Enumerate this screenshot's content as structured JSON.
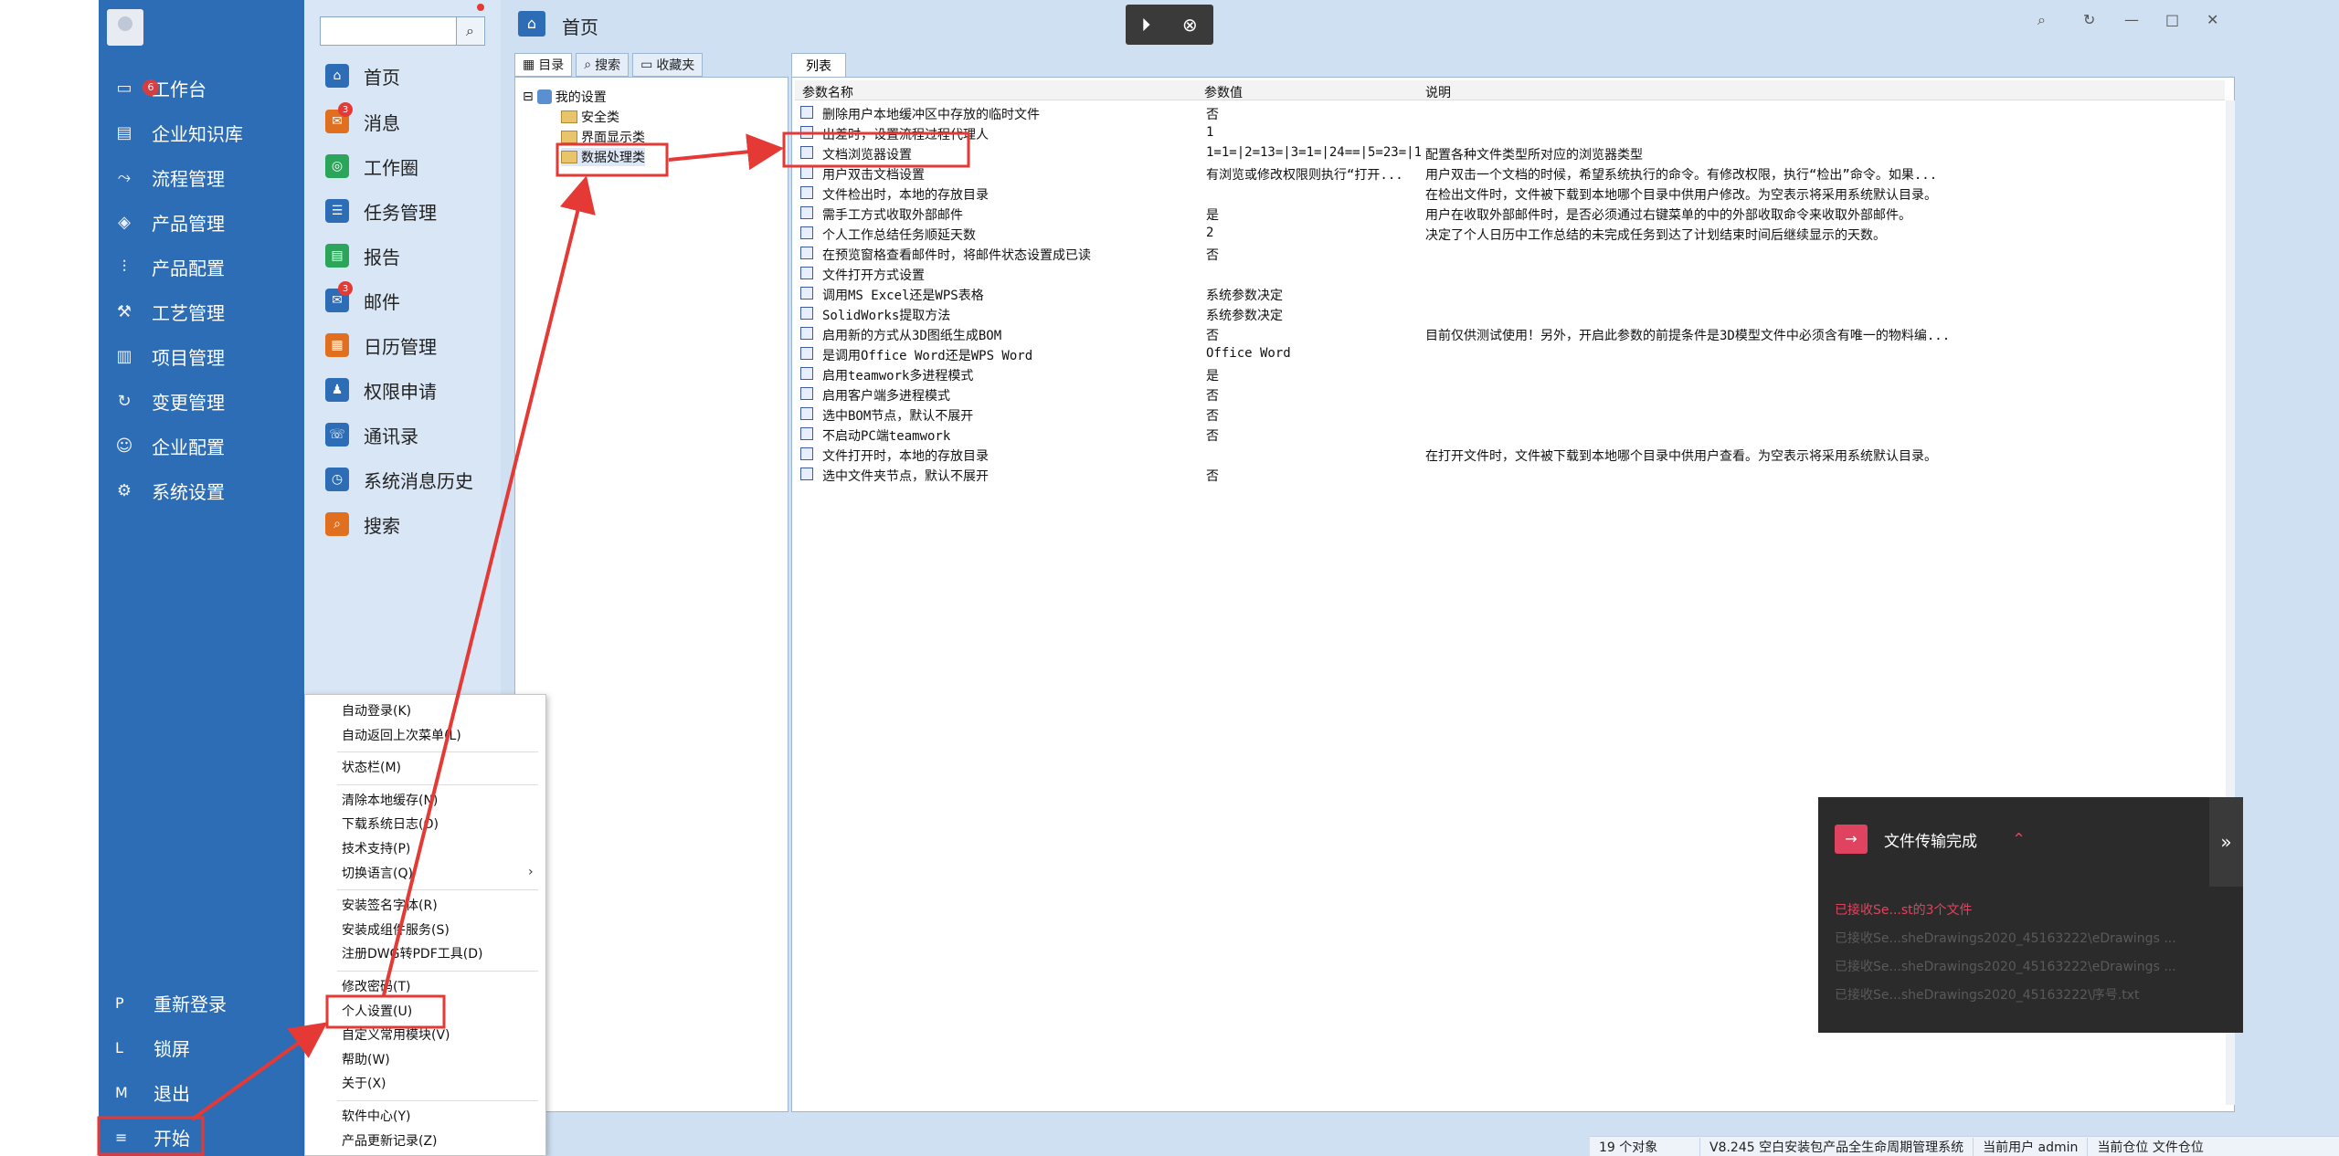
{
  "sidebar": {
    "items": [
      {
        "label": "工作台",
        "icon": "monitor-icon",
        "badge": "6"
      },
      {
        "label": "企业知识库",
        "icon": "book-icon"
      },
      {
        "label": "流程管理",
        "icon": "flow-icon"
      },
      {
        "label": "产品管理",
        "icon": "cube-icon"
      },
      {
        "label": "产品配置",
        "icon": "sliders-icon"
      },
      {
        "label": "工艺管理",
        "icon": "wrench-icon"
      },
      {
        "label": "项目管理",
        "icon": "chart-icon"
      },
      {
        "label": "变更管理",
        "icon": "refresh-icon"
      },
      {
        "label": "企业配置",
        "icon": "users-icon"
      },
      {
        "label": "系统设置",
        "icon": "gear-icon"
      }
    ],
    "bottom": [
      {
        "key": "P",
        "label": "重新登录"
      },
      {
        "key": "L",
        "label": "锁屏"
      },
      {
        "key": "M",
        "label": "退出"
      },
      {
        "key": "≡",
        "label": "开始"
      }
    ]
  },
  "menu2": {
    "items": [
      {
        "label": "首页",
        "color": "#2d6db5",
        "icon": "home-icon"
      },
      {
        "label": "消息",
        "color": "#e07020",
        "icon": "message-icon",
        "badge": "3"
      },
      {
        "label": "工作圈",
        "color": "#2aa55a",
        "icon": "circle-icon"
      },
      {
        "label": "任务管理",
        "color": "#2d6db5",
        "icon": "task-icon"
      },
      {
        "label": "报告",
        "color": "#2aa55a",
        "icon": "report-icon"
      },
      {
        "label": "邮件",
        "color": "#2d6db5",
        "icon": "mail-icon",
        "badge": "3"
      },
      {
        "label": "日历管理",
        "color": "#e07020",
        "icon": "calendar-icon"
      },
      {
        "label": "权限申请",
        "color": "#2d6db5",
        "icon": "permission-icon"
      },
      {
        "label": "通讯录",
        "color": "#2d6db5",
        "icon": "contacts-icon"
      },
      {
        "label": "系统消息历史",
        "color": "#2d6db5",
        "icon": "history-icon"
      },
      {
        "label": "搜索",
        "color": "#e07020",
        "icon": "search-icon"
      }
    ]
  },
  "header": {
    "title": "首页"
  },
  "left_tabs": [
    "目录",
    "搜索",
    "收藏夹"
  ],
  "tree": {
    "root": "我的设置",
    "children": [
      "安全类",
      "界面显示类",
      "数据处理类"
    ]
  },
  "list": {
    "tab": "列表",
    "columns": [
      "参数名称",
      "参数值",
      "说明"
    ],
    "rows": [
      [
        "删除用户本地缓冲区中存放的临时文件",
        "否",
        ""
      ],
      [
        "出差时，设置流程过程代理人",
        "1",
        ""
      ],
      [
        "文档浏览器设置",
        "1=1=|2=13=|3=1=|24==|5=23=|1...",
        "配置各种文件类型所对应的浏览器类型"
      ],
      [
        "用户双击文档设置",
        "有浏览或修改权限则执行“打开...",
        "用户双击一个文档的时候，希望系统执行的命令。有修改权限，执行“检出”命令。如果..."
      ],
      [
        "文件检出时，本地的存放目录",
        "",
        "在检出文件时，文件被下载到本地哪个目录中供用户修改。为空表示将采用系统默认目录。"
      ],
      [
        "需手工方式收取外部邮件",
        "是",
        "用户在收取外部邮件时，是否必须通过右键菜单的中的外部收取命令来收取外部邮件。"
      ],
      [
        "个人工作总结任务顺延天数",
        "2",
        "决定了个人日历中工作总结的未完成任务到达了计划结束时间后继续显示的天数。"
      ],
      [
        "在预览窗格查看邮件时，将邮件状态设置成已读",
        "否",
        ""
      ],
      [
        "文件打开方式设置",
        "",
        ""
      ],
      [
        "调用MS Excel还是WPS表格",
        "系统参数决定",
        ""
      ],
      [
        "SolidWorks提取方法",
        "系统参数决定",
        ""
      ],
      [
        "启用新的方式从3D图纸生成BOM",
        "否",
        "目前仅供测试使用！另外，开启此参数的前提条件是3D模型文件中必须含有唯一的物料编..."
      ],
      [
        "是调用Office Word还是WPS Word",
        "Office Word",
        ""
      ],
      [
        "启用teamwork多进程模式",
        "是",
        ""
      ],
      [
        "启用客户端多进程模式",
        "否",
        ""
      ],
      [
        "选中BOM节点，默认不展开",
        "否",
        ""
      ],
      [
        "不启动PC端teamwork",
        "否",
        ""
      ],
      [
        "文件打开时，本地的存放目录",
        "",
        "在打开文件时，文件被下载到本地哪个目录中供用户查看。为空表示将采用系统默认目录。"
      ],
      [
        "选中文件夹节点，默认不展开",
        "否",
        ""
      ]
    ]
  },
  "status": {
    "count": "19 个对象",
    "product": "V8.245 空白安装包产品全生命周期管理系统",
    "user": "当前用户 admin",
    "location": "当前仓位 文件仓位"
  },
  "context_menu": {
    "groups": [
      [
        "自动登录(K)",
        "自动返回上次菜单(L)"
      ],
      [
        "状态栏(M)"
      ],
      [
        "清除本地缓存(N)",
        "下载系统日志(O)",
        "技术支持(P)",
        "切换语言(Q)"
      ],
      [
        "安装签名字体(R)",
        "安装成组件服务(S)",
        "注册DWG转PDF工具(D)"
      ],
      [
        "修改密码(T)",
        "个人设置(U)",
        "自定义常用模块(V)",
        "帮助(W)",
        "关于(X)"
      ],
      [
        "软件中心(Y)",
        "产品更新记录(Z)"
      ]
    ]
  },
  "notification": {
    "title": "文件传输完成",
    "lines": [
      "已接收Se...st的3个文件",
      "已接收Se...sheDrawings2020_45163222\\eDrawings ...",
      "已接收Se...sheDrawings2020_45163222\\eDrawings ...",
      "已接收Se...sheDrawings2020_45163222\\序号.txt"
    ]
  },
  "colors": {
    "sidebar": "#2d6db5",
    "accent_red": "#e53935",
    "notif_pink": "#e0435f"
  }
}
